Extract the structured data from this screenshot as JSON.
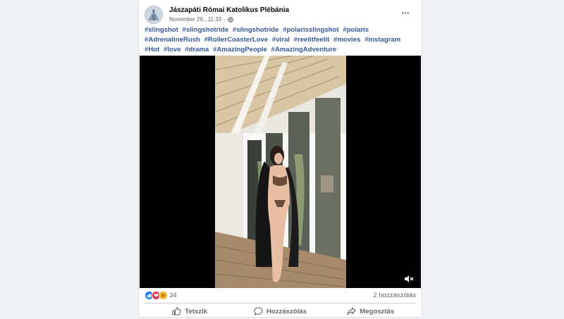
{
  "post": {
    "page_name": "Jászapáti Római Katolikus Plébánia",
    "timestamp": "November 26., 11:33",
    "separator": "·",
    "privacy_icon": "globe-icon",
    "more_icon": "more-options-icon",
    "hashtags": [
      "#slingshot",
      "#slingshotride",
      "#slingshotride",
      "#polarisslingshot",
      "#polaris",
      "#AdrenalineRush",
      "#RollerCoasterLove",
      "#viral",
      "#reelitfeelit",
      "#movies",
      "#instagram",
      "#Hot",
      "#love",
      "#drama",
      "#AmazingPeople",
      "#AmazingAdventure"
    ]
  },
  "video": {
    "mute_icon": "speaker-muted-icon"
  },
  "stats": {
    "reactions": [
      "like",
      "love",
      "haha"
    ],
    "reaction_count": "34",
    "comments_count": "2 hozzászólás"
  },
  "actions": {
    "like_label": "Tetszik",
    "comment_label": "Hozzászólás",
    "share_label": "Megosztás"
  },
  "colors": {
    "link": "#385898",
    "like_blue": "#1877f2",
    "love_red": "#f02849",
    "haha_yellow": "#f7b125"
  }
}
